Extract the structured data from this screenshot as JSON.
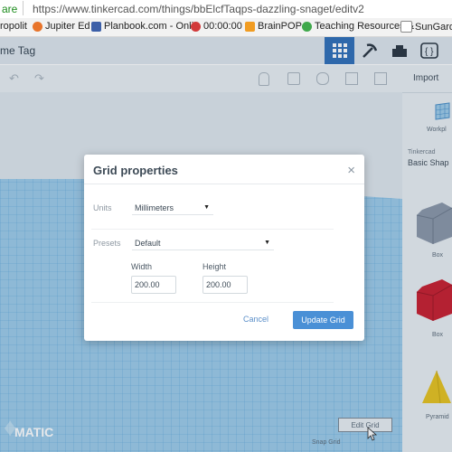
{
  "browser": {
    "security_label": "are",
    "url": "https://www.tinkercad.com/things/bbElcfTaqps-dazzling-snaget/editv2",
    "bookmarks": [
      {
        "label": "Jupiter Ed",
        "color": "#e8742a"
      },
      {
        "label": "Planbook.com - Onli",
        "color": "#3c5fa8"
      },
      {
        "label": "00:00:00",
        "color": "#d23a3a"
      },
      {
        "label": "BrainPOP",
        "color": "#f19c22"
      },
      {
        "label": "Teaching Resources &",
        "color": "#3fa84b"
      },
      {
        "label": "SunGard P",
        "color": "#8a8a8a"
      }
    ],
    "bookmark_fragment": "ropolit"
  },
  "app": {
    "title_fragment": "me Tag",
    "import_label": "Import"
  },
  "sidebar": {
    "workplane_label": "Workpl",
    "category_small": "Tinkercad",
    "category_select": "Basic Shap",
    "shapes": [
      {
        "name": "Box",
        "color": "#8a97a8"
      },
      {
        "name": "Box",
        "color": "#c81e2e"
      },
      {
        "name": "Pyramid",
        "color": "#e6c21e"
      }
    ]
  },
  "workplane": {
    "watermark": "MATIC",
    "edit_grid_label": "Edit Grid",
    "snap_grid_label": "Snap Grid"
  },
  "dialog": {
    "title": "Grid properties",
    "close_symbol": "×",
    "units_label": "Units",
    "units_value": "Millimeters",
    "presets_label": "Presets",
    "presets_value": "Default",
    "width_label": "Width",
    "width_value": "200.00",
    "height_label": "Height",
    "height_value": "200.00",
    "cancel_label": "Cancel",
    "update_label": "Update Grid"
  },
  "colors": {
    "accent": "#4a90d6",
    "header_active": "#2f6fb8",
    "workplane_grid": "#5fa8d8"
  }
}
